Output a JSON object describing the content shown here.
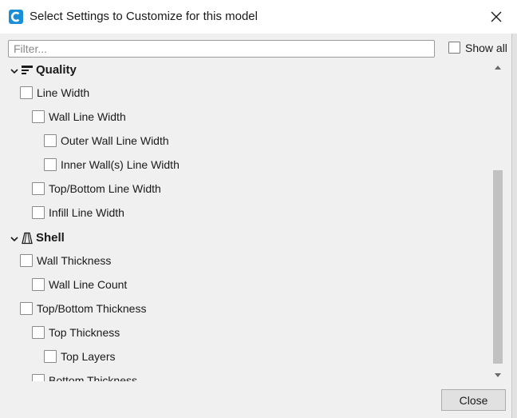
{
  "window": {
    "title": "Select Settings to Customize for this model",
    "app_icon": "cura-icon",
    "close_icon": "close-icon"
  },
  "filter": {
    "placeholder": "Filter...",
    "value": ""
  },
  "show_all": {
    "label": "Show all",
    "checked": false
  },
  "categories": [
    {
      "label": "Quality",
      "icon": "quality-icon",
      "expanded": true,
      "items": [
        {
          "label": "Line Width",
          "checked": false
        },
        {
          "label": "Wall Line Width",
          "checked": false
        },
        {
          "label": "Outer Wall Line Width",
          "checked": false
        },
        {
          "label": "Inner Wall(s) Line Width",
          "checked": false
        },
        {
          "label": "Top/Bottom Line Width",
          "checked": false
        },
        {
          "label": "Infill Line Width",
          "checked": false
        }
      ]
    },
    {
      "label": "Shell",
      "icon": "shell-icon",
      "expanded": true,
      "items": [
        {
          "label": "Wall Thickness",
          "checked": false
        },
        {
          "label": "Wall Line Count",
          "checked": false
        },
        {
          "label": "Top/Bottom Thickness",
          "checked": false
        },
        {
          "label": "Top Thickness",
          "checked": false
        },
        {
          "label": "Top Layers",
          "checked": false
        },
        {
          "label": "Bottom Thickness",
          "checked": false
        }
      ]
    }
  ],
  "footer": {
    "close_label": "Close"
  },
  "colors": {
    "accent": "#1a8fd8",
    "dialog_bg": "#f0f0f0",
    "titlebar_bg": "#ffffff"
  }
}
